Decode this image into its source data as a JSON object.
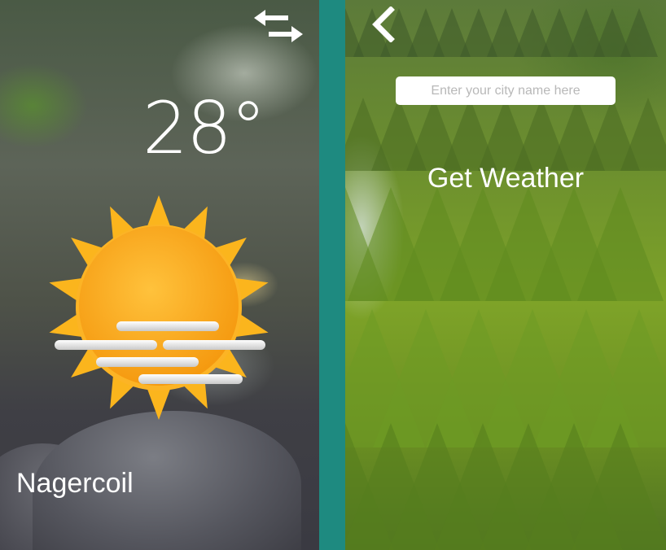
{
  "weather_screen": {
    "temperature": "28°",
    "city": "Nagercoil",
    "condition_icon": "sun-with-haze-icon",
    "switch_icon": "swap-arrows-icon"
  },
  "change_city_screen": {
    "back_icon": "chevron-left-icon",
    "input": {
      "placeholder": "Enter your city name here",
      "value": ""
    },
    "get_weather_label": "Get Weather"
  },
  "colors": {
    "divider": "#1e8a80",
    "sun_outer": "#f8b21c",
    "sun_inner": "#fca820",
    "text": "#ffffff"
  }
}
